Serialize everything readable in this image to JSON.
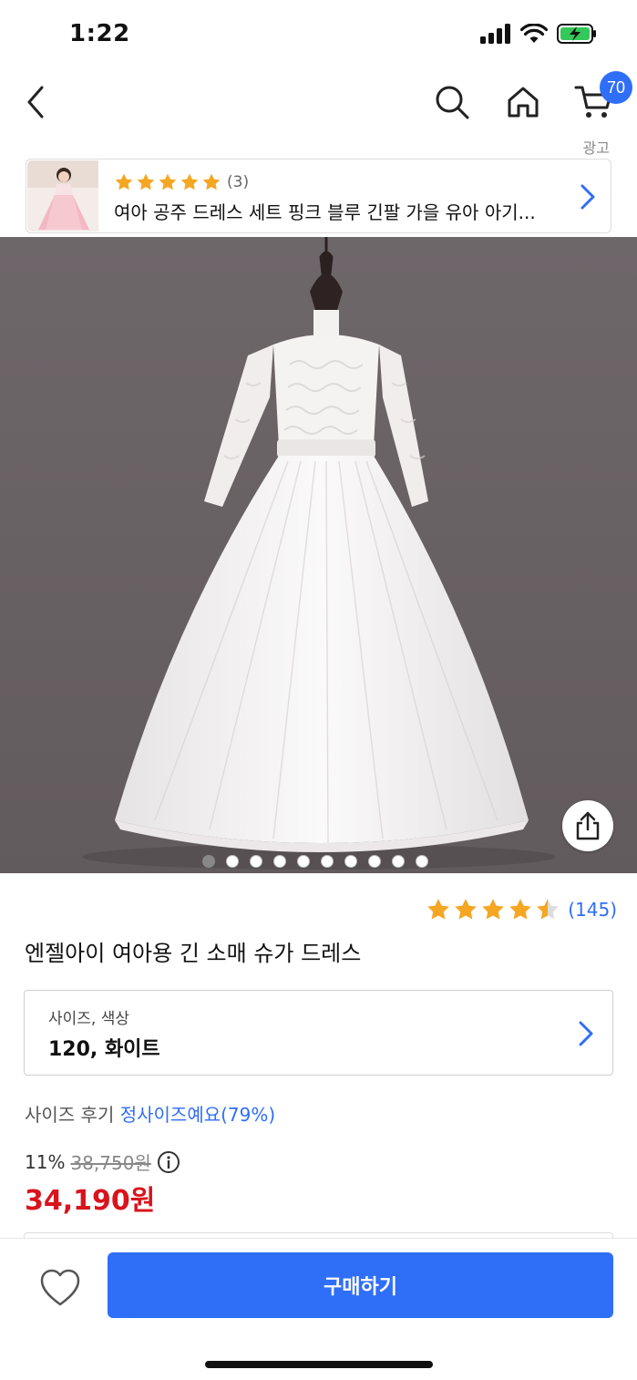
{
  "status_bar": {
    "time": "1:22"
  },
  "nav": {
    "cart_count": "70",
    "icons": [
      "back-icon",
      "search-icon",
      "home-icon",
      "cart-icon"
    ]
  },
  "ad": {
    "label": "광고",
    "rating": 5,
    "review_count": "(3)",
    "title": "여아 공주 드레스 세트 핑크 블루 긴팔 가을 유아 아기..."
  },
  "gallery": {
    "image_count": 10,
    "active_index": 0
  },
  "product": {
    "rating": 4.5,
    "review_count": "(145)",
    "title": "엔젤아이 여아용 긴 소매 슈가 드레스"
  },
  "option": {
    "label": "사이즈, 색상",
    "value": "120, 화이트"
  },
  "size_review": {
    "label": "사이즈 후기",
    "value": "정사이즈예요(79%)"
  },
  "price": {
    "discount": "11%",
    "original": "38,750원",
    "final": "34,190원"
  },
  "bottom_bar": {
    "buy_label": "구매하기"
  },
  "colors": {
    "accent": "#2f6ef7",
    "price_red": "#d8141c",
    "star": "#f5a623"
  }
}
